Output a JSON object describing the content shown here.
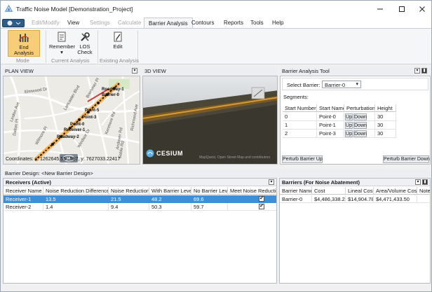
{
  "window": {
    "title": "Traffic Noise Model [Demonstration_Project]",
    "minimize_icon": "minimize-icon",
    "maximize_icon": "maximize-icon",
    "close_icon": "close-icon"
  },
  "ribbon": {
    "tabs": [
      {
        "label": "Edit/Modify",
        "state": "disabled"
      },
      {
        "label": "View",
        "state": "normal"
      },
      {
        "label": "Settings",
        "state": "disabled"
      },
      {
        "label": "Calculate",
        "state": "disabled"
      },
      {
        "label": "Barrier Analysis",
        "state": "active"
      },
      {
        "label": "Contours",
        "state": "normal"
      },
      {
        "label": "Reports",
        "state": "normal"
      },
      {
        "label": "Tools",
        "state": "normal"
      },
      {
        "label": "Help",
        "state": "normal"
      }
    ],
    "buttons": {
      "end_analysis": {
        "label": "End Analysis",
        "icon": "end-analysis-icon"
      },
      "remember": {
        "label": "Remember",
        "icon": "remember-icon",
        "arrow": "▾"
      },
      "los_check": {
        "label": "LOS Check",
        "icon": "tools-icon"
      },
      "edit": {
        "label": "Edit",
        "icon": "edit-document-icon"
      }
    },
    "groups": {
      "mode": "Mode",
      "current_analysis": "Current Analysis",
      "existing_analysis": "Existing Analysis"
    }
  },
  "plan_view": {
    "title": "PLAN VIEW",
    "coordinates": "Coordinates: x: 1262645.55 1587, y: 7627033.22417",
    "street_labels": [
      "Elmwood Dr",
      "Lindon Ave",
      "Dalton Pl",
      "Lancaster Blvd",
      "Bremmer Pl",
      "Wilmore Pl",
      "Kenmore Rd",
      "Windsor Dr",
      "Richmond Ave",
      "Andover Rd",
      "Gable Rd"
    ],
    "feature_labels": [
      "Roadway-1",
      "Barrier-0",
      "Point-5",
      "Point-3",
      "Point-0",
      "Receiver-1",
      "Roadway-2"
    ]
  },
  "view_3d": {
    "title": "3D VIEW",
    "logo_text": "CESIUM",
    "attribution": "MapQuest, Open Street Map and contributors"
  },
  "barrier_tool": {
    "title": "Barrier Analysis Tool",
    "select_label": "Select Barrier:",
    "select_value": "Barrier-0",
    "segments_label": "Segments:",
    "columns": [
      "Start Number",
      "Start Name",
      "Perturbation",
      "Height"
    ],
    "rows": [
      {
        "start_number": "0",
        "start_name": "Point-0",
        "up": "Up",
        "down": "Down",
        "height": "30"
      },
      {
        "start_number": "1",
        "start_name": "Point-1",
        "up": "Up",
        "down": "Down",
        "height": "30"
      },
      {
        "start_number": "2",
        "start_name": "Point-3",
        "up": "Up",
        "down": "Down",
        "height": "30"
      }
    ],
    "perturb_up": "Perturb Barrier Up",
    "perturb_down": "Perturb Barrier Down"
  },
  "barrier_design": {
    "header": "Barrier Design: <New Barrier Design>"
  },
  "receivers": {
    "title": "Receivers (Active)",
    "columns": [
      "Receiver Name",
      "Noise Reduction Difference",
      "Noise Reduction",
      "With Barrier Level",
      "No Barrier Level",
      "Meet Noise Reduction"
    ],
    "rows": [
      {
        "name": "Receiver-1",
        "nrd": "13.5",
        "nr": "21.5",
        "wbl": "48.2",
        "nbl": "69.6",
        "meet": "✔",
        "selected": true
      },
      {
        "name": "Receiver-2",
        "nrd": "1.4",
        "nr": "9.4",
        "wbl": "50.3",
        "nbl": "59.7",
        "meet": "✔",
        "selected": false
      }
    ]
  },
  "barriers": {
    "title": "Barriers (For Noise Abatement)",
    "columns": [
      "Barrier Name",
      "Cost",
      "Lineal Cost",
      "Area/Volume Cost",
      "Notes"
    ],
    "rows": [
      {
        "name": "Barrier-0",
        "cost": "$4,486,338.28",
        "lineal": "$14,904.78",
        "area": "$4,471,433.50",
        "notes": ""
      }
    ]
  },
  "colors": {
    "accent": "#3d8fd8",
    "selected_button": "#f7cd77",
    "app_menu": "#2f5d8a"
  }
}
